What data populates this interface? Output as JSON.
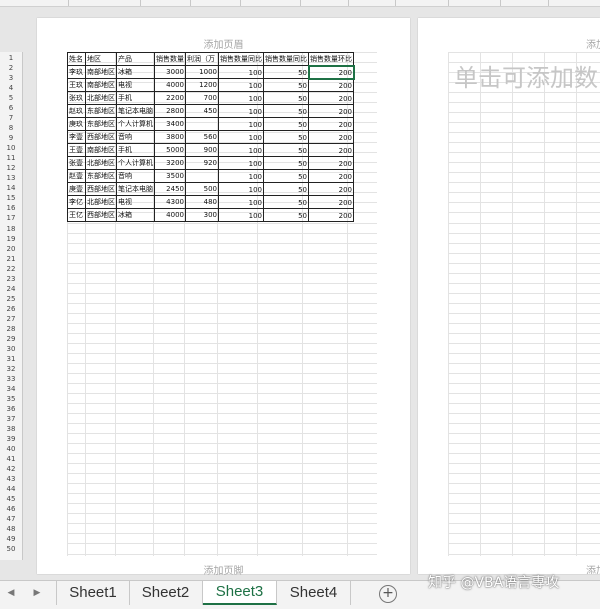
{
  "page": {
    "header_placeholder": "添加页眉",
    "footer_placeholder": "添加页脚",
    "page2_placeholder": "单击可添加数",
    "page2_header_clip": "添加",
    "page2_footer_clip": "添加"
  },
  "row_numbers": [
    "1",
    "2",
    "3",
    "4",
    "5",
    "6",
    "7",
    "8",
    "9",
    "10",
    "11",
    "12",
    "13",
    "14",
    "15",
    "16",
    "17",
    "18",
    "19",
    "20",
    "21",
    "22",
    "23",
    "24",
    "25",
    "26",
    "27",
    "28",
    "29",
    "30",
    "31",
    "32",
    "33",
    "34",
    "35",
    "36",
    "37",
    "38",
    "39",
    "40",
    "41",
    "42",
    "43",
    "44",
    "45",
    "46",
    "47",
    "48",
    "49",
    "50"
  ],
  "table": {
    "headers": [
      "姓名",
      "地区",
      "产品",
      "销售数量",
      "利润（万",
      "销售数量同比",
      "销售数量同比",
      "销售数量环比"
    ],
    "rows": [
      [
        "李玖",
        "南部地区",
        "冰箱",
        "3000",
        "1000",
        "100",
        "50",
        "200"
      ],
      [
        "王玖",
        "南部地区",
        "电视",
        "4000",
        "1200",
        "100",
        "50",
        "200"
      ],
      [
        "张玖",
        "北部地区",
        "手机",
        "2200",
        "700",
        "100",
        "50",
        "200"
      ],
      [
        "赵玖",
        "东部地区",
        "笔记本电脑",
        "2800",
        "450",
        "100",
        "50",
        "200"
      ],
      [
        "庚玖",
        "东部地区",
        "个人计算机",
        "3400",
        "",
        "100",
        "50",
        "200"
      ],
      [
        "李壹",
        "西部地区",
        "音响",
        "3800",
        "560",
        "100",
        "50",
        "200"
      ],
      [
        "王壹",
        "南部地区",
        "手机",
        "5000",
        "900",
        "100",
        "50",
        "200"
      ],
      [
        "张壹",
        "北部地区",
        "个人计算机",
        "3200",
        "920",
        "100",
        "50",
        "200"
      ],
      [
        "赵壹",
        "东部地区",
        "音响",
        "3500",
        "",
        "100",
        "50",
        "200"
      ],
      [
        "庚壹",
        "西部地区",
        "笔记本电脑",
        "2450",
        "500",
        "100",
        "50",
        "200"
      ],
      [
        "李亿",
        "北部地区",
        "电视",
        "4300",
        "480",
        "100",
        "50",
        "200"
      ],
      [
        "王亿",
        "西部地区",
        "冰箱",
        "4000",
        "300",
        "100",
        "50",
        "200"
      ]
    ]
  },
  "tabs": [
    {
      "label": "Sheet1",
      "active": false
    },
    {
      "label": "Sheet2",
      "active": false
    },
    {
      "label": "Sheet3",
      "active": true
    },
    {
      "label": "Sheet4",
      "active": false
    }
  ],
  "tab_nav": {
    "prev": "◀",
    "next": "▶",
    "add": "+"
  },
  "watermark": "知乎 @VBA语言専攻",
  "colors": {
    "accent": "#1e7145",
    "placeholder": "#a6a6a6"
  }
}
